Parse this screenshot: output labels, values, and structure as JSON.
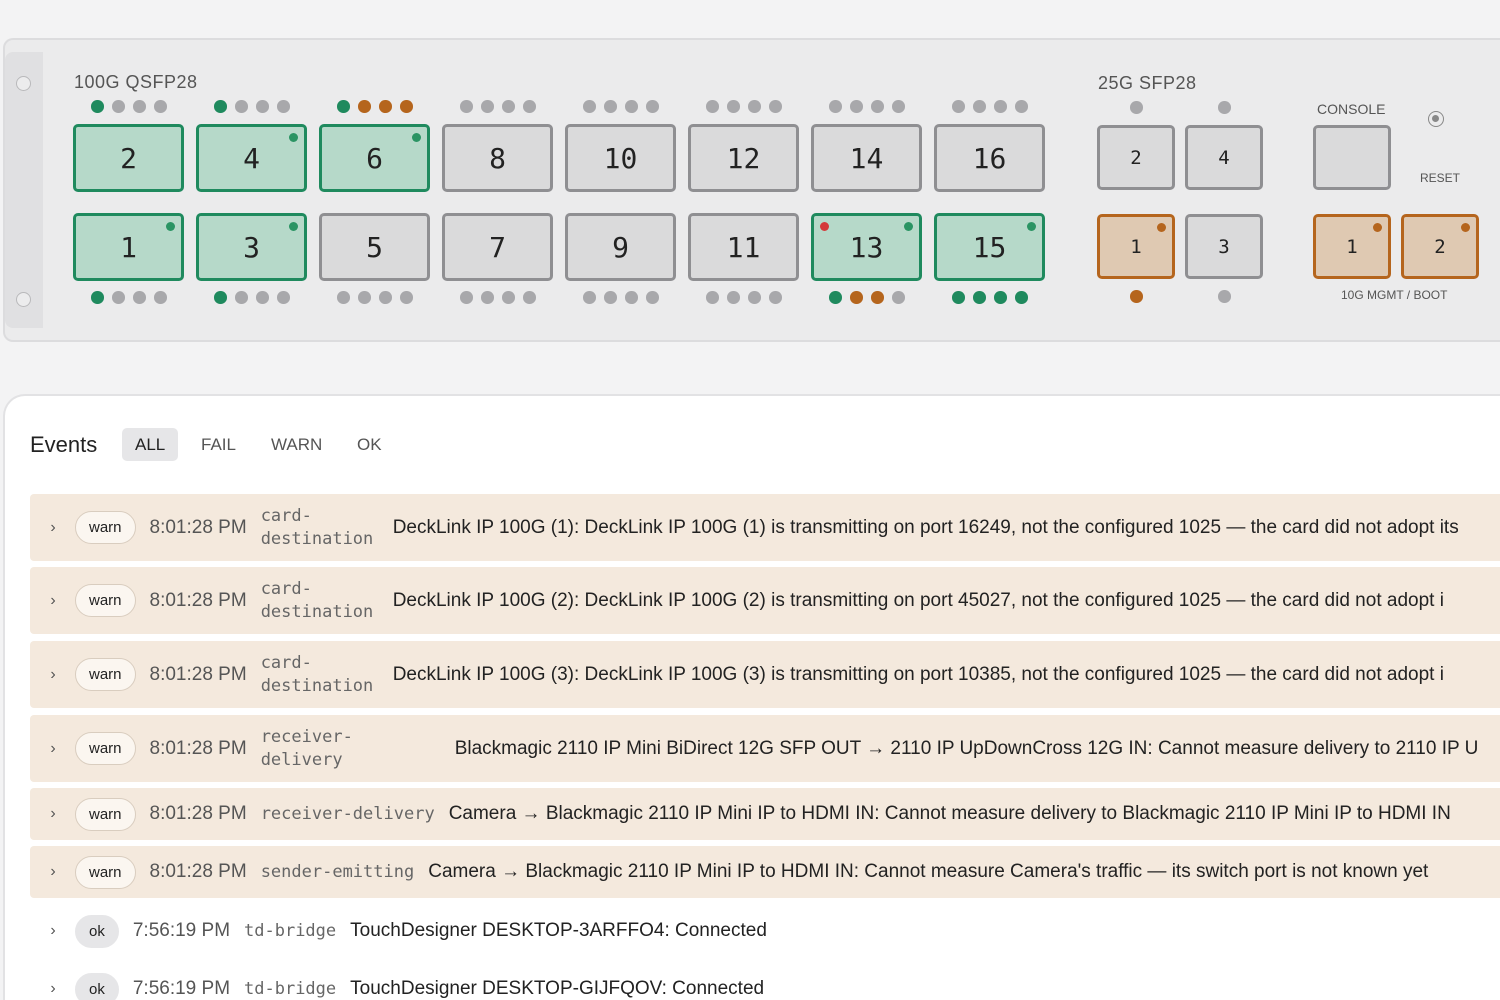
{
  "switch": {
    "qsfp_label": "100G QSFP28",
    "sfp_label": "25G SFP28",
    "console_label": "CONSOLE",
    "reset_label": "RESET",
    "mgmt_label": "10G MGMT / BOOT",
    "qsfp_top": [
      {
        "label": "2",
        "state": "green",
        "led": "",
        "dots": [
          "g",
          "x",
          "x",
          "x"
        ]
      },
      {
        "label": "4",
        "state": "green",
        "led": "green",
        "dots": [
          "g",
          "x",
          "x",
          "x"
        ]
      },
      {
        "label": "6",
        "state": "green",
        "led": "green",
        "dots": [
          "g",
          "a",
          "a",
          "a"
        ]
      },
      {
        "label": "8",
        "state": "gray",
        "led": "",
        "dots": [
          "x",
          "x",
          "x",
          "x"
        ]
      },
      {
        "label": "10",
        "state": "gray",
        "led": "",
        "dots": [
          "x",
          "x",
          "x",
          "x"
        ]
      },
      {
        "label": "12",
        "state": "gray",
        "led": "",
        "dots": [
          "x",
          "x",
          "x",
          "x"
        ]
      },
      {
        "label": "14",
        "state": "gray",
        "led": "",
        "dots": [
          "x",
          "x",
          "x",
          "x"
        ]
      },
      {
        "label": "16",
        "state": "gray",
        "led": "",
        "dots": [
          "x",
          "x",
          "x",
          "x"
        ]
      }
    ],
    "qsfp_bottom": [
      {
        "label": "1",
        "state": "green",
        "led": "green",
        "dots": [
          "g",
          "x",
          "x",
          "x"
        ]
      },
      {
        "label": "3",
        "state": "green",
        "led": "green",
        "dots": [
          "g",
          "x",
          "x",
          "x"
        ]
      },
      {
        "label": "5",
        "state": "gray",
        "led": "",
        "dots": [
          "x",
          "x",
          "x",
          "x"
        ]
      },
      {
        "label": "7",
        "state": "gray",
        "led": "",
        "dots": [
          "x",
          "x",
          "x",
          "x"
        ]
      },
      {
        "label": "9",
        "state": "gray",
        "led": "",
        "dots": [
          "x",
          "x",
          "x",
          "x"
        ]
      },
      {
        "label": "11",
        "state": "gray",
        "led": "",
        "dots": [
          "x",
          "x",
          "x",
          "x"
        ]
      },
      {
        "label": "13",
        "state": "green",
        "led": "green",
        "red_led": true,
        "dots": [
          "g",
          "a",
          "a",
          "x"
        ]
      },
      {
        "label": "15",
        "state": "green",
        "led": "green",
        "dots": [
          "g",
          "g",
          "g",
          "g"
        ]
      }
    ],
    "sfp_top": [
      {
        "label": "2",
        "state": "gray",
        "led": "",
        "dots": [
          "x"
        ]
      },
      {
        "label": "4",
        "state": "gray",
        "led": "",
        "dots": [
          "x"
        ]
      }
    ],
    "sfp_bottom": [
      {
        "label": "1",
        "state": "amber",
        "led": "amber",
        "dots": [
          "a"
        ]
      },
      {
        "label": "3",
        "state": "gray",
        "led": "",
        "dots": [
          "x"
        ]
      }
    ],
    "mgmt": [
      {
        "label": "1",
        "state": "amber",
        "led": "amber"
      },
      {
        "label": "2",
        "state": "amber",
        "led": "amber"
      }
    ]
  },
  "events": {
    "title": "Events",
    "filters": [
      "ALL",
      "FAIL",
      "WARN",
      "OK"
    ],
    "active_filter": "ALL",
    "rows": [
      {
        "level": "warn",
        "time": "8:01:28 PM",
        "source": "card-\ndestination",
        "message": "DeckLink IP 100G (1): DeckLink IP 100G (1) is transmitting on port 16249, not the configured 1025 — the card did not adopt its"
      },
      {
        "level": "warn",
        "time": "8:01:28 PM",
        "source": "card-\ndestination",
        "message": "DeckLink IP 100G (2): DeckLink IP 100G (2) is transmitting on port 45027, not the configured 1025 — the card did not adopt i"
      },
      {
        "level": "warn",
        "time": "8:01:28 PM",
        "source": "card-\ndestination",
        "message": "DeckLink IP 100G (3): DeckLink IP 100G (3) is transmitting on port 10385, not the configured 1025 — the card did not adopt i"
      },
      {
        "level": "warn",
        "time": "8:01:28 PM",
        "source": "receiver-\ndelivery",
        "message": "Blackmagic 2110 IP Mini BiDirect 12G SFP OUT → 2110 IP UpDownCross 12G IN: Cannot measure delivery to 2110 IP U"
      },
      {
        "level": "warn",
        "time": "8:01:28 PM",
        "source": "receiver-delivery",
        "message": "Camera → Blackmagic 2110 IP Mini IP to HDMI IN: Cannot measure delivery to Blackmagic 2110 IP Mini IP to HDMI IN"
      },
      {
        "level": "warn",
        "time": "8:01:28 PM",
        "source": "sender-emitting",
        "message": "Camera → Blackmagic 2110 IP Mini IP to HDMI IN: Cannot measure Camera's traffic — its switch port is not known yet"
      },
      {
        "level": "ok",
        "time": "7:56:19 PM",
        "source": "td-bridge",
        "message": "TouchDesigner DESKTOP-3ARFFO4: Connected"
      },
      {
        "level": "ok",
        "time": "7:56:19 PM",
        "source": "td-bridge",
        "message": "TouchDesigner DESKTOP-GIJFQOV: Connected"
      }
    ]
  }
}
